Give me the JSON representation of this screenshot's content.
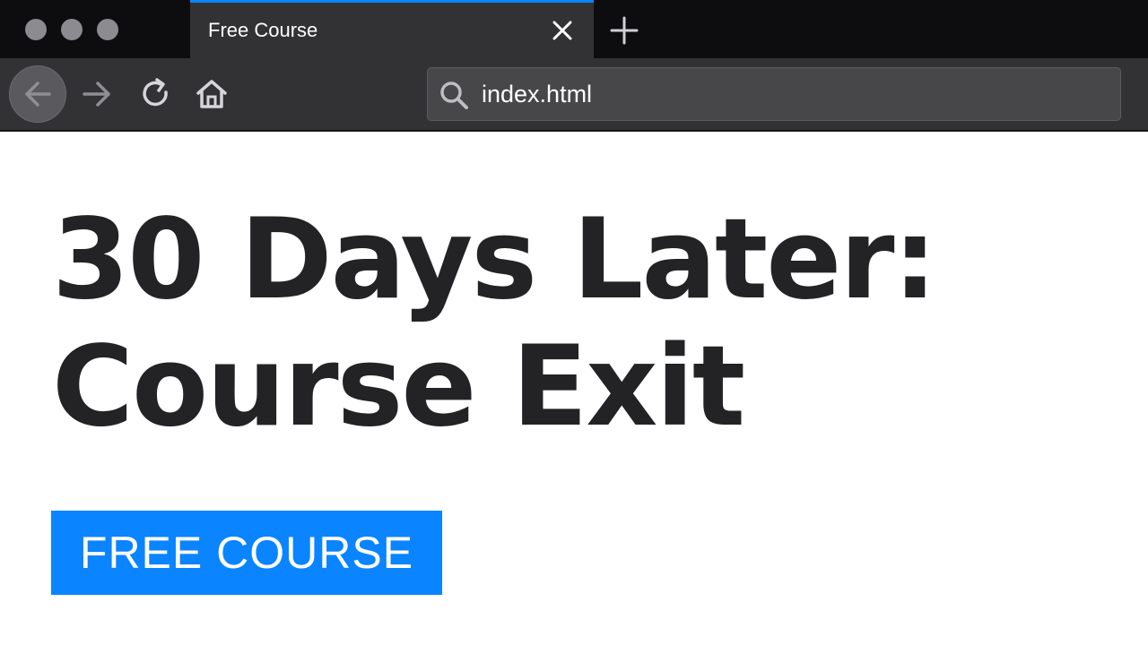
{
  "browser": {
    "window_controls": [
      "close",
      "minimize",
      "zoom"
    ],
    "tab": {
      "title": "Free Course",
      "close_icon": "close-icon",
      "active_indicator_color": "#0a84ff"
    },
    "new_tab_icon": "plus-icon",
    "toolbar": {
      "back_icon": "arrow-left-icon",
      "forward_icon": "arrow-right-icon",
      "reload_icon": "reload-icon",
      "home_icon": "home-icon"
    },
    "address_bar": {
      "icon": "search-icon",
      "value": "index.html"
    }
  },
  "page": {
    "heading_line1": "30 Days Later:",
    "heading_line2": "Course Exit",
    "cta_label": "FREE COURSE",
    "cta_color": "#0a84ff",
    "heading_color": "#232326"
  }
}
